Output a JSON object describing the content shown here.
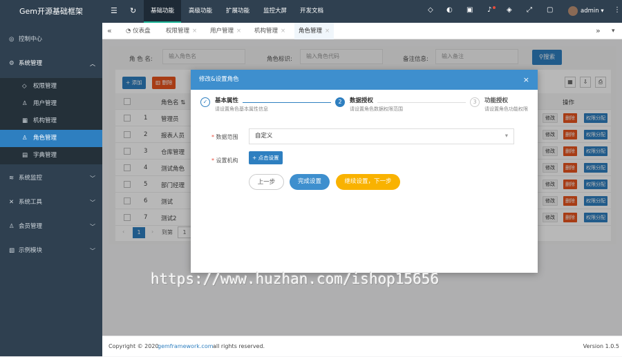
{
  "app": {
    "title": "Gem开源基础框架"
  },
  "header": {
    "nav": [
      "基础功能",
      "高级功能",
      "扩展功能",
      "监控大屏",
      "开发文档"
    ],
    "active_nav": "基础功能",
    "user": "admin",
    "icons": [
      "menu-toggle-icon",
      "refresh-icon",
      "diamond-icon",
      "theme-icon",
      "message-icon",
      "bell-icon",
      "tag-icon",
      "fullscreen-icon",
      "lock-icon",
      "more-icon"
    ]
  },
  "sidebar": {
    "groups": [
      {
        "label": "控制中心",
        "icon": "dashboard-icon"
      },
      {
        "label": "系统管理",
        "icon": "settings-icon",
        "expanded": true
      },
      {
        "label": "系统监控",
        "icon": "monitor-icon"
      },
      {
        "label": "系统工具",
        "icon": "tools-icon"
      },
      {
        "label": "会员管理",
        "icon": "member-icon"
      },
      {
        "label": "示例模块",
        "icon": "example-icon"
      }
    ],
    "sub_items": [
      {
        "label": "权限管理",
        "icon": "shield-icon"
      },
      {
        "label": "用户管理",
        "icon": "user-icon"
      },
      {
        "label": "机构管理",
        "icon": "org-icon"
      },
      {
        "label": "角色管理",
        "icon": "role-icon",
        "active": true
      },
      {
        "label": "字典管理",
        "icon": "dict-icon"
      }
    ]
  },
  "tabs": [
    {
      "label": "仪表盘",
      "closable": false
    },
    {
      "label": "权限管理",
      "closable": true
    },
    {
      "label": "用户管理",
      "closable": true
    },
    {
      "label": "机构管理",
      "closable": true
    },
    {
      "label": "角色管理",
      "closable": true,
      "active": true
    }
  ],
  "filters": [
    {
      "label": "角 色 名:",
      "placeholder": "输入角色名"
    },
    {
      "label": "角色标识:",
      "placeholder": "输入角色代码"
    },
    {
      "label": "备注信息:",
      "placeholder": "输入备注"
    }
  ],
  "search_label": "搜索",
  "toolbar": {
    "add_label": "添加",
    "delete_label": "删除"
  },
  "table": {
    "columns": [
      "角色名",
      "操作"
    ],
    "rows": [
      {
        "num": "1",
        "name": "管理员"
      },
      {
        "num": "2",
        "name": "报表人员"
      },
      {
        "num": "3",
        "name": "仓库管理"
      },
      {
        "num": "4",
        "name": "测试角色"
      },
      {
        "num": "5",
        "name": "部门经理"
      },
      {
        "num": "6",
        "name": "测试"
      },
      {
        "num": "7",
        "name": "测试2"
      }
    ],
    "row_actions": {
      "edit": "修改",
      "delete": "删除",
      "perm": "权限分配"
    }
  },
  "pager": {
    "current": "1",
    "goto_label": "到第",
    "goto_value": "1"
  },
  "modal": {
    "title": "修改&设置角色",
    "steps": [
      {
        "num": "✓",
        "title": "基本属性",
        "desc": "请设置角色基本属性信息"
      },
      {
        "num": "2",
        "title": "数据授权",
        "desc": "请设置角色数据权限范围"
      },
      {
        "num": "3",
        "title": "功能授权",
        "desc": "请设置角色功能权限"
      }
    ],
    "scope_label": "数据范围",
    "scope_value": "自定义",
    "org_label": "设置机构",
    "org_button": "点击设置",
    "prev_label": "上一步",
    "finish_label": "完成设置",
    "next_label": "继续设置，下一步"
  },
  "footer": {
    "copyright": "Copyright © 2020",
    "link": "gemframework.com",
    "rights": "all rights reserved.",
    "version": "Version 1.0.5"
  },
  "watermark": "https://www.huzhan.com/ishop15656",
  "colors": {
    "sidebar": "#2f4050",
    "primary": "#2e7fc0",
    "danger": "#e8541e",
    "warning": "#f9b200",
    "modal_header": "#3e8fce"
  }
}
